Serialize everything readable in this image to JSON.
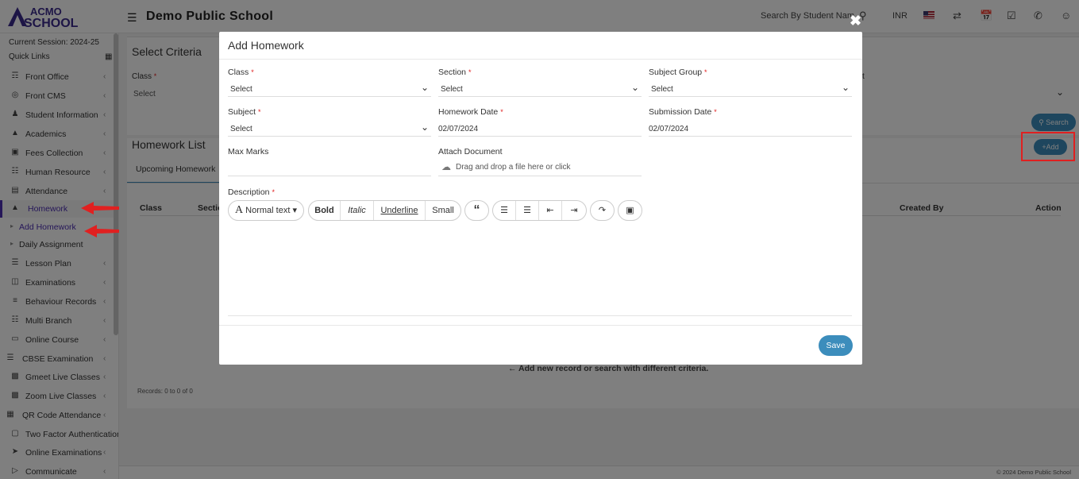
{
  "header": {
    "brand": "ACMO SCHOOL",
    "school_name": "Demo Public School",
    "search_placeholder": "Search By Student Nam",
    "currency": "INR"
  },
  "sidebar": {
    "session": "Current Session: 2024-25",
    "quick_links": "Quick Links",
    "items": [
      {
        "label": "Front Office",
        "icon": "front-office-icon"
      },
      {
        "label": "Front CMS",
        "icon": "globe-icon"
      },
      {
        "label": "Student Information",
        "icon": "student-icon"
      },
      {
        "label": "Academics",
        "icon": "graduation-cap-icon"
      },
      {
        "label": "Fees Collection",
        "icon": "money-icon"
      },
      {
        "label": "Human Resource",
        "icon": "sitemap-icon"
      },
      {
        "label": "Attendance",
        "icon": "calendar-icon"
      },
      {
        "label": "Homework",
        "icon": "flask-icon"
      }
    ],
    "subitems": [
      {
        "label": "Add Homework"
      },
      {
        "label": "Daily Assignment"
      }
    ],
    "items2": [
      {
        "label": "Lesson Plan",
        "icon": "list-icon"
      },
      {
        "label": "Examinations",
        "icon": "map-icon"
      },
      {
        "label": "Behaviour Records",
        "icon": "sliders-icon"
      },
      {
        "label": "Multi Branch",
        "icon": "sitemap-icon"
      },
      {
        "label": "Online Course",
        "icon": "laptop-icon"
      },
      {
        "label": "CBSE Examination",
        "icon": "list-icon"
      },
      {
        "label": "Gmeet Live Classes",
        "icon": "video-icon"
      },
      {
        "label": "Zoom Live Classes",
        "icon": "video-icon"
      },
      {
        "label": "QR Code Attendance",
        "icon": "qrcode-icon"
      },
      {
        "label": "Two Factor Authentication",
        "icon": "lock-icon"
      },
      {
        "label": "Online Examinations",
        "icon": "rocket-icon"
      },
      {
        "label": "Communicate",
        "icon": "bullhorn-icon"
      }
    ]
  },
  "criteria": {
    "title": "Select Criteria",
    "class_label": "Class",
    "class_value": "Select",
    "search_button": "Search"
  },
  "homework_list": {
    "title": "Homework List",
    "add_button": "Add",
    "tab_upcoming": "Upcoming Homework",
    "columns": [
      "Class",
      "Sectio",
      "Created By",
      "Action"
    ],
    "empty_message": "Add new record or search with different criteria.",
    "records": "Records: 0 to 0 of 0"
  },
  "footer": "© 2024 Demo Public School",
  "modal": {
    "title": "Add Homework",
    "class_label": "Class",
    "class_value": "Select",
    "section_label": "Section",
    "section_value": "Select",
    "subject_group_label": "Subject Group",
    "subject_group_value": "Select",
    "subject_label": "Subject",
    "subject_value": "Select",
    "homework_date_label": "Homework Date",
    "homework_date_value": "02/07/2024",
    "submission_date_label": "Submission Date",
    "submission_date_value": "02/07/2024",
    "max_marks_label": "Max Marks",
    "attach_label": "Attach Document",
    "attach_placeholder": "Drag and drop a file here or click",
    "description_label": "Description",
    "toolbar": {
      "normal_text": "Normal text",
      "bold": "Bold",
      "italic": "Italic",
      "underline": "Underline",
      "small": "Small"
    },
    "save_button": "Save",
    "required_mark": "*"
  },
  "colors": {
    "accent": "#3c8dbc",
    "active_nav": "#4d2fb2",
    "annotation": "#e02020"
  }
}
